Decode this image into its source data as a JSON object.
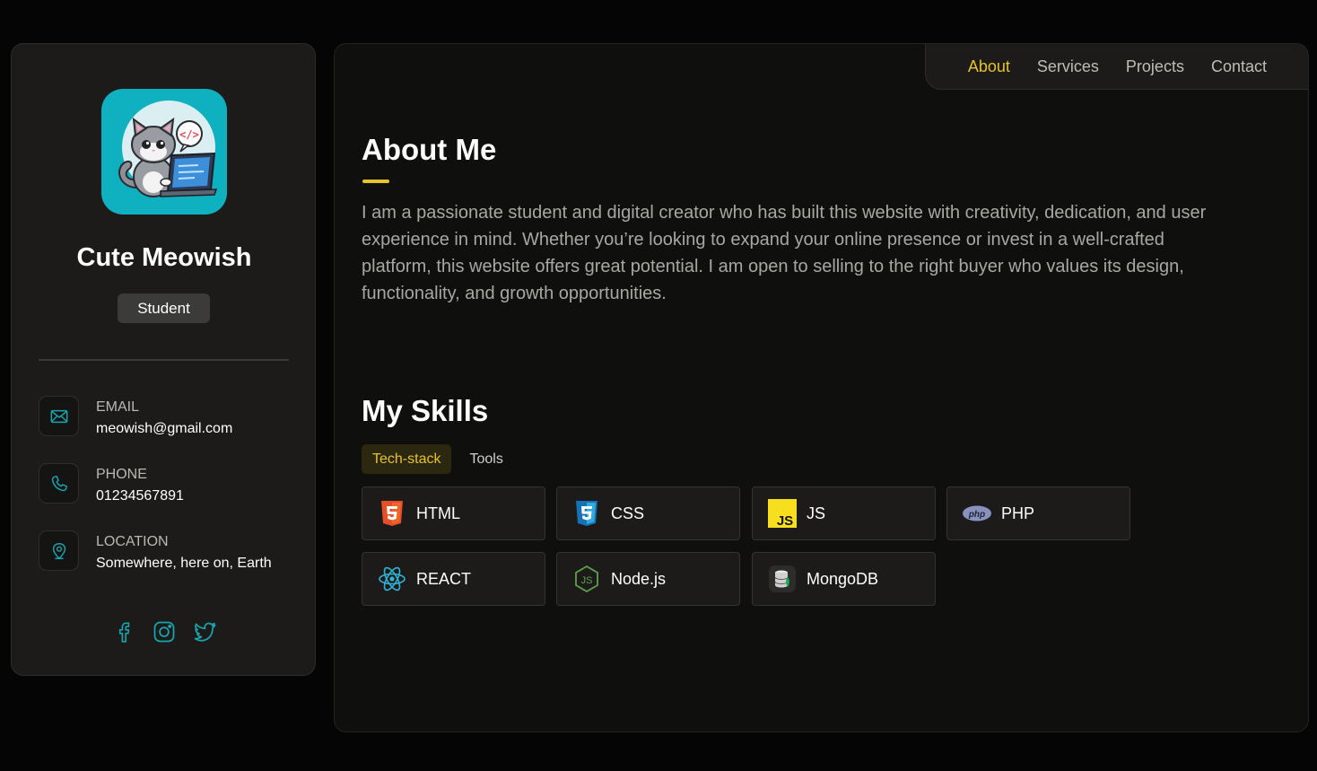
{
  "profile": {
    "name": "Cute Meowish",
    "role": "Student"
  },
  "contacts": [
    {
      "label": "EMAIL",
      "value": "meowish@gmail.com",
      "icon": "mail-icon"
    },
    {
      "label": "PHONE",
      "value": "01234567891",
      "icon": "phone-icon"
    },
    {
      "label": "LOCATION",
      "value": "Somewhere, here on, Earth",
      "icon": "location-icon"
    }
  ],
  "socials": [
    "facebook-icon",
    "instagram-icon",
    "twitter-icon"
  ],
  "nav": {
    "items": [
      "About",
      "Services",
      "Projects",
      "Contact"
    ],
    "active": "About"
  },
  "about": {
    "title": "About Me",
    "text": "I am a passionate student and digital creator who has built this website with creativity, dedication, and user experience in mind. Whether you’re looking to expand your online presence or invest in a well-crafted platform, this website offers great potential. I am open to selling to the right buyer who values its design, functionality, and growth opportunities."
  },
  "skills": {
    "title": "My Skills",
    "tabs": [
      "Tech-stack",
      "Tools"
    ],
    "active_tab": "Tech-stack",
    "items": [
      {
        "name": "HTML",
        "icon": "html5-icon"
      },
      {
        "name": "CSS",
        "icon": "css3-icon"
      },
      {
        "name": "JS",
        "icon": "javascript-icon"
      },
      {
        "name": "PHP",
        "icon": "php-icon"
      },
      {
        "name": "REACT",
        "icon": "react-icon"
      },
      {
        "name": "Node.js",
        "icon": "nodejs-icon"
      },
      {
        "name": "MongoDB",
        "icon": "mongodb-icon"
      }
    ]
  },
  "colors": {
    "accent": "#e5c32d",
    "icon_teal": "#1aa3ad",
    "avatar_bg": "#0fb0bf"
  }
}
